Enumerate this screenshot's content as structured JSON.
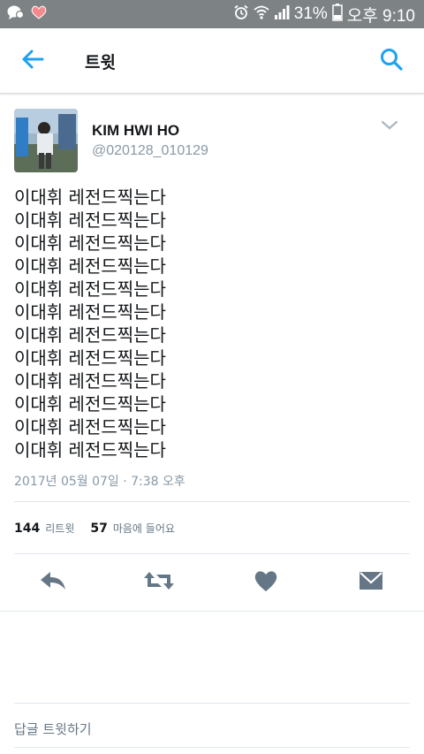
{
  "status_bar": {
    "battery": "31%",
    "carrier_time": "오후 9:10",
    "icons": [
      "message-icon",
      "heart-icon",
      "alarm-icon",
      "wifi-icon",
      "signal-icon",
      "battery-icon"
    ]
  },
  "header": {
    "title": "트윗",
    "back_icon": "arrow-left-icon",
    "search_icon": "search-icon"
  },
  "tweet": {
    "author_name": "KIM HWI HO",
    "author_handle": "@020128_010129",
    "lines": [
      "이대휘 레전드찍는다",
      "이대휘 레전드찍는다",
      "이대휘 레전드찍는다",
      "이대휘 레전드찍는다",
      "이대휘 레전드찍는다",
      "이대휘 레전드찍는다",
      "이대휘 레전드찍는다",
      "이대휘 레전드찍는다",
      "이대휘 레전드찍는다",
      "이대휘 레전드찍는다",
      "이대휘 레전드찍는다",
      "이대휘 레전드찍는다"
    ],
    "timestamp": "2017년 05월 07일 · 7:38 오후"
  },
  "stats": {
    "retweets_count": "144",
    "retweets_label": "리트윗",
    "likes_count": "57",
    "likes_label": "마음에 들어요"
  },
  "actions": [
    "reply-icon",
    "retweet-icon",
    "like-heart-icon",
    "direct-message-icon"
  ],
  "reply": {
    "placeholder": "답글 트윗하기"
  },
  "colors": {
    "status_bar": "#7d8285",
    "accent": "#1da1f2",
    "icon_gray": "#657786",
    "muted_text": "#8899a6"
  }
}
